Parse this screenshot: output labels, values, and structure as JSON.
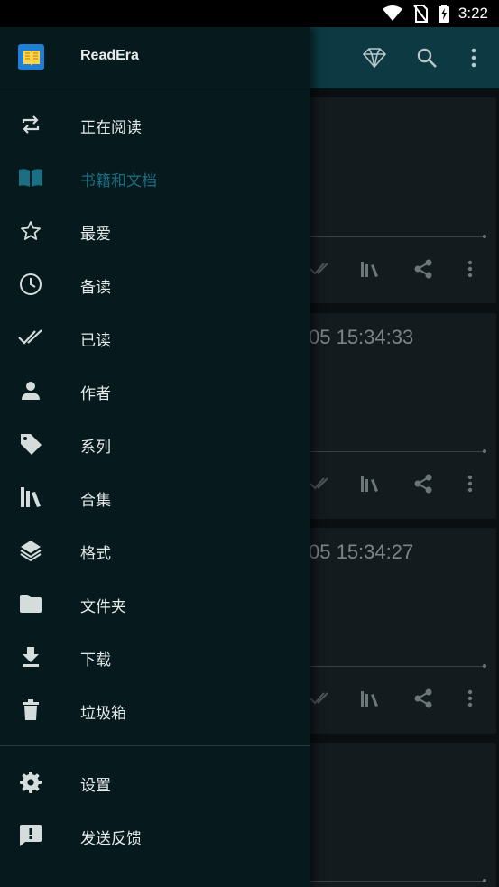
{
  "status_bar": {
    "time": "3:22",
    "icons": [
      "wifi-icon",
      "no-sim-icon",
      "battery-charging-icon"
    ]
  },
  "app": {
    "toolbar_icons": [
      "diamond-icon",
      "search-icon",
      "more-vert-icon"
    ],
    "cards": [
      {
        "timestamp": ""
      },
      {
        "timestamp": "05 15:34:33"
      },
      {
        "timestamp": "05 15:34:27"
      },
      {
        "timestamp": ""
      }
    ],
    "card_action_icons": [
      "done-all-icon",
      "library-icon",
      "share-icon",
      "more-vert-icon"
    ]
  },
  "drawer": {
    "app_name": "ReadEra",
    "items": [
      {
        "label": "正在阅读",
        "icon": "repeat-icon",
        "active": false
      },
      {
        "label": "书籍和文档",
        "icon": "book-icon",
        "active": true
      },
      {
        "label": "最爱",
        "icon": "star-icon",
        "active": false
      },
      {
        "label": "备读",
        "icon": "clock-icon",
        "active": false
      },
      {
        "label": "已读",
        "icon": "done-all-icon",
        "active": false
      },
      {
        "label": "作者",
        "icon": "person-icon",
        "active": false
      },
      {
        "label": "系列",
        "icon": "tag-icon",
        "active": false
      },
      {
        "label": "合集",
        "icon": "library-icon",
        "active": false
      },
      {
        "label": "格式",
        "icon": "layers-icon",
        "active": false
      },
      {
        "label": "文件夹",
        "icon": "folder-icon",
        "active": false
      },
      {
        "label": "下载",
        "icon": "download-icon",
        "active": false
      },
      {
        "label": "垃圾箱",
        "icon": "trash-icon",
        "active": false
      }
    ],
    "bottom_items": [
      {
        "label": "设置",
        "icon": "settings-icon"
      },
      {
        "label": "发送反馈",
        "icon": "feedback-icon"
      }
    ]
  },
  "colors": {
    "drawer_bg": "#06191d",
    "toolbar_bg": "#0d3a42",
    "active_accent": "#1b6f82",
    "icon_color": "#d5dcdc"
  }
}
